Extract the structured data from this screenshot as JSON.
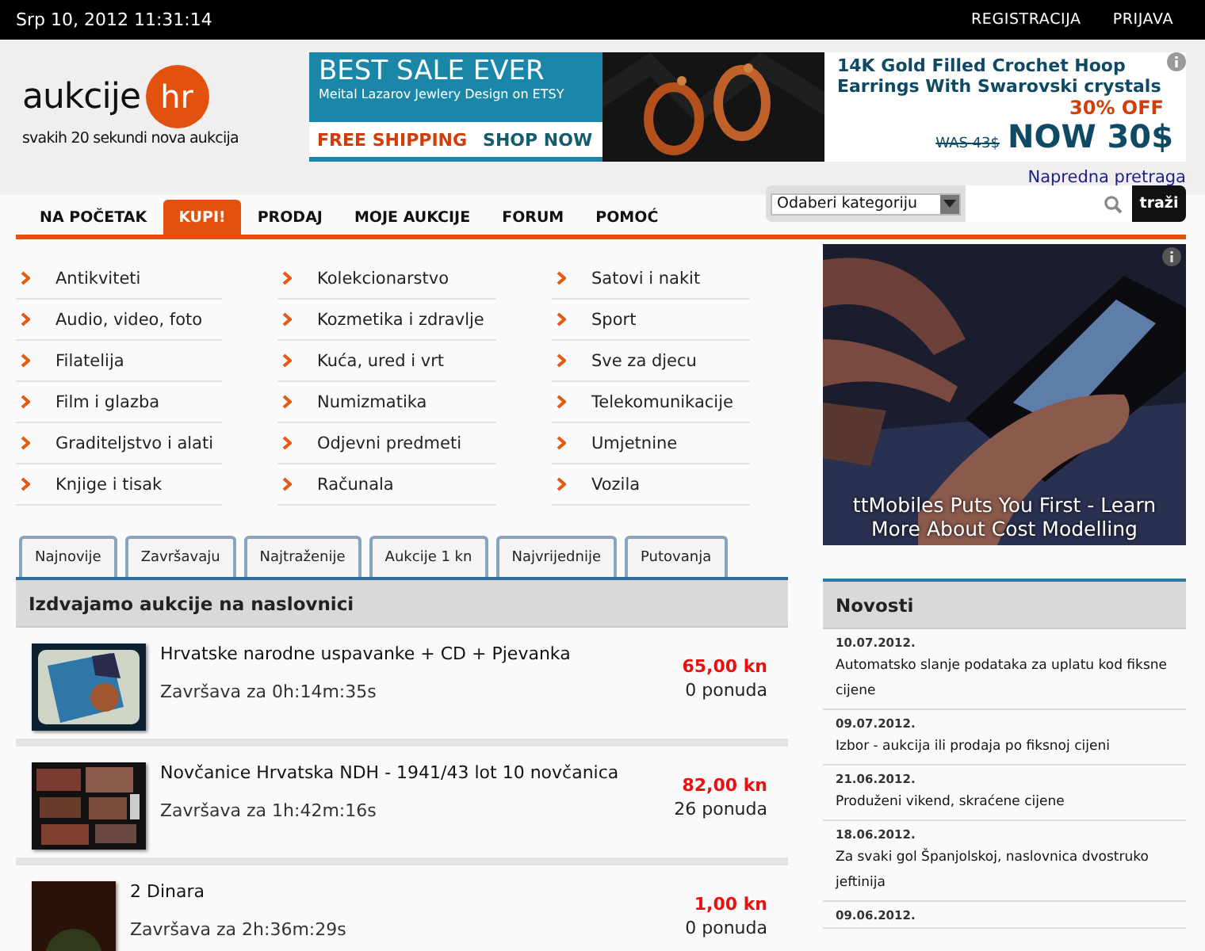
{
  "top_bar": {
    "datetime": "Srp 10, 2012 11:31:14",
    "links": [
      "REGISTRACIJA",
      "PRIJAVA"
    ]
  },
  "logo": {
    "text": "aukcije",
    "domain": "hr",
    "tagline": "svakih 20 sekundi nova aukcija"
  },
  "banner_ad": {
    "headline": "BEST SALE EVER",
    "subline": "Meital Lazarov Jewlery Design on ETSY",
    "left_cta": "FREE SHIPPING",
    "right_cta": "SHOP NOW",
    "product": "14K Gold Filled Crochet Hoop Earrings With Swarovski crystals",
    "discount": "30% OFF",
    "old_price": "WAS 43$",
    "new_price": "NOW 30$"
  },
  "advanced_search": "Napredna pretraga",
  "nav": [
    {
      "label": "NA POČETAK",
      "selected": false
    },
    {
      "label": "KUPI!",
      "selected": true
    },
    {
      "label": "PRODAJ",
      "selected": false
    },
    {
      "label": "MOJE AUKCIJE",
      "selected": false
    },
    {
      "label": "FORUM",
      "selected": false
    },
    {
      "label": "POMOĆ",
      "selected": false
    }
  ],
  "search": {
    "category": "Odaberi kategoriju",
    "button": "traži"
  },
  "categories": [
    [
      "Antikviteti",
      "Audio, video, foto",
      "Filatelija",
      "Film i glazba",
      "Graditeljstvo i alati",
      "Knjige i tisak"
    ],
    [
      "Kolekcionarstvo",
      "Kozmetika i zdravlje",
      "Kuća, ured i vrt",
      "Numizmatika",
      "Odjevni predmeti",
      "Računala"
    ],
    [
      "Satovi i nakit",
      "Sport",
      "Sve za djecu",
      "Telekomunikacije",
      "Umjetnine",
      "Vozila"
    ]
  ],
  "tabs": [
    "Najnovije",
    "Završavaju",
    "Najtraženije",
    "Aukcije 1 kn",
    "Najvrijednije",
    "Putovanja"
  ],
  "featured": {
    "title": "Izdvajamo aukcije na naslovnici",
    "items": [
      {
        "title": "Hrvatske narodne uspavanke + CD + Pjevanka",
        "ends": "Završava za 0h:14m:35s",
        "price": "65,00 kn",
        "bids": "0 ponuda"
      },
      {
        "title": "Novčanice Hrvatska NDH - 1941/43 lot 10 novčanica",
        "ends": "Završava za 1h:42m:16s",
        "price": "82,00 kn",
        "bids": "26 ponuda"
      },
      {
        "title": "2 Dinara",
        "ends": "Završava za 2h:36m:29s",
        "price": "1,00 kn",
        "bids": "0 ponuda"
      }
    ]
  },
  "side_ad": {
    "caption": "ttMobiles Puts You First - Learn More About Cost Modelling"
  },
  "news": {
    "title": "Novosti",
    "items": [
      {
        "date": "10.07.2012.",
        "text": "Automatsko slanje podataka za uplatu kod fiksne cijene"
      },
      {
        "date": "09.07.2012.",
        "text": "Izbor - aukcija ili prodaja po fiksnoj cijeni"
      },
      {
        "date": "21.06.2012.",
        "text": "Produženi vikend, skraćene cijene"
      },
      {
        "date": "18.06.2012.",
        "text": "Za svaki gol Španjolskoj, naslovnica dvostruko jeftinija"
      },
      {
        "date": "09.06.2012."
      }
    ]
  }
}
